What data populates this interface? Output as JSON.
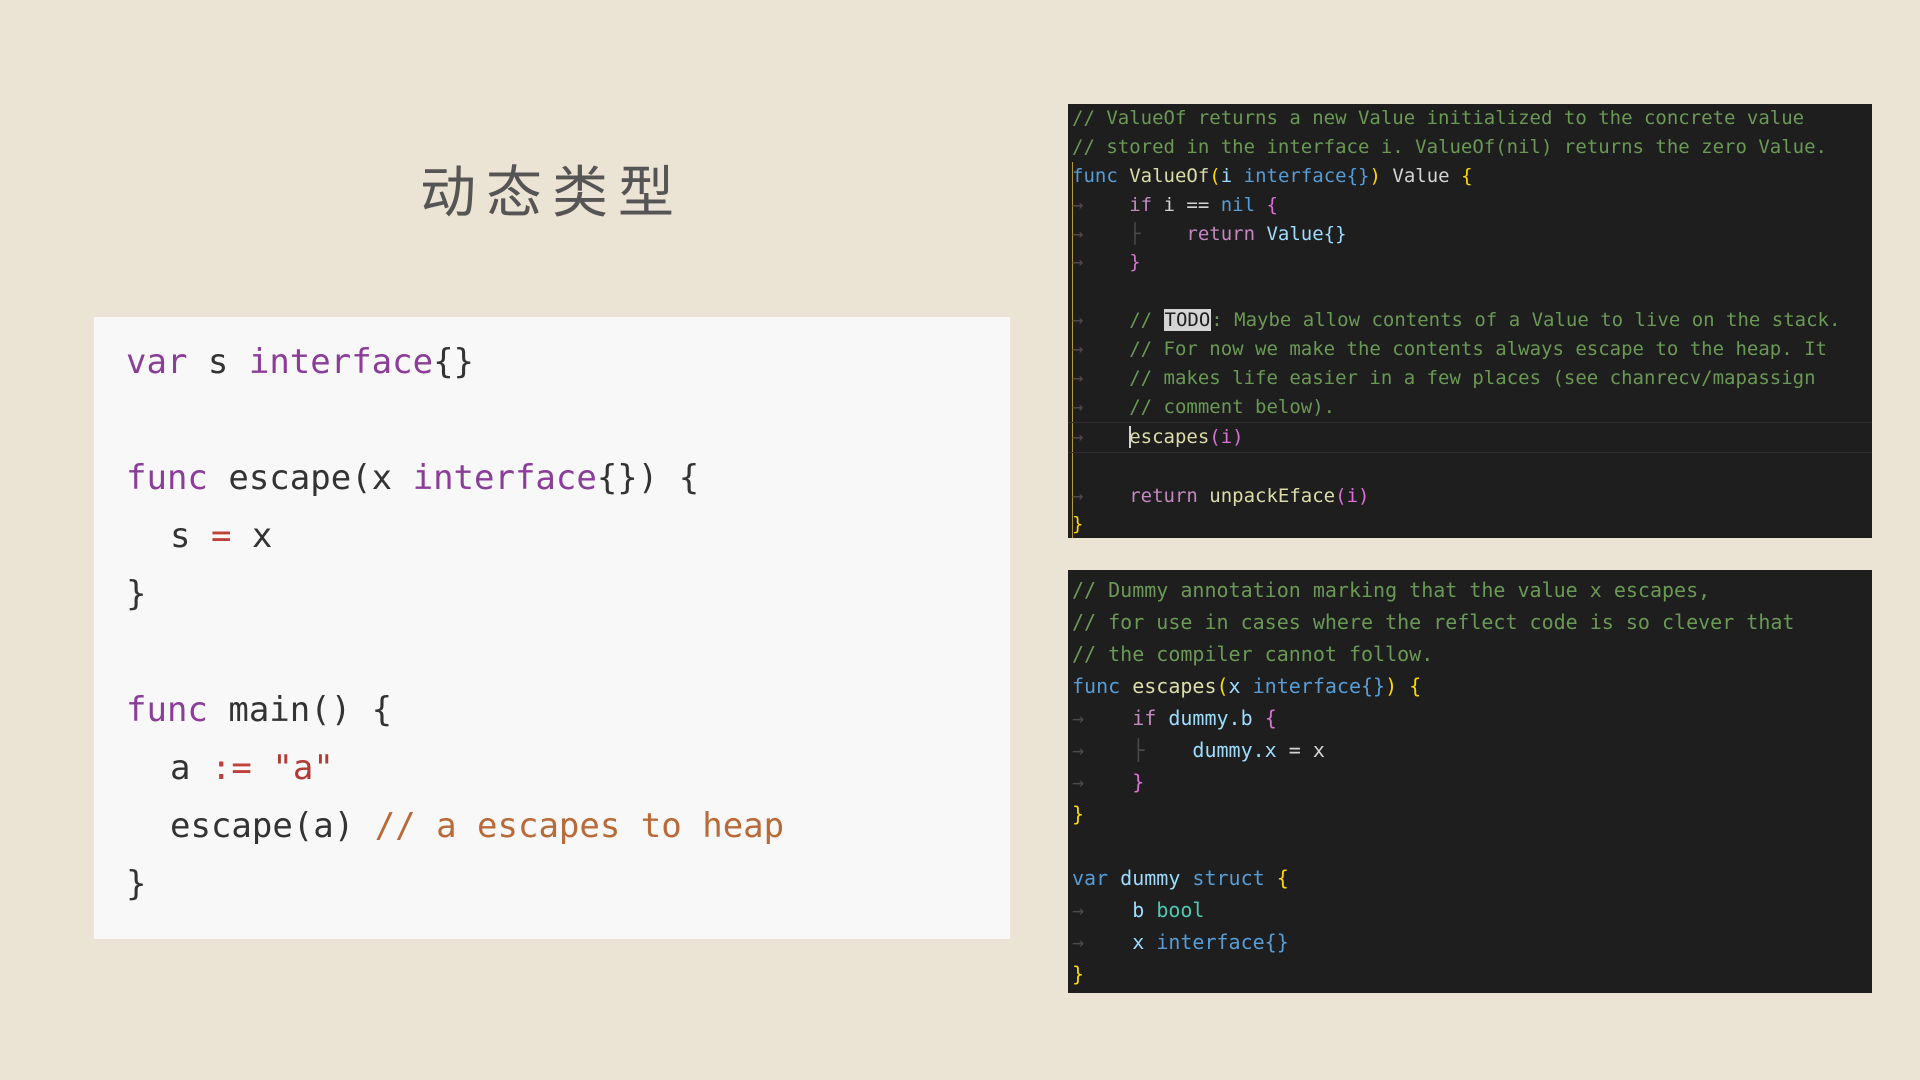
{
  "slide": {
    "title": "动态类型"
  },
  "left_code": {
    "line1": {
      "kw": "var",
      "mid": " s ",
      "type": "interface",
      "rest": "{}"
    },
    "line3": {
      "kw": "func",
      "name": " escape(x ",
      "type": "interface",
      "rest": "{}) {"
    },
    "line4": {
      "a": "s ",
      "op": "=",
      "b": " x"
    },
    "line5": "}",
    "line7": {
      "kw": "func",
      "rest": " main() {"
    },
    "line8": {
      "a": "a ",
      "op": ":=",
      "str": " \"a\""
    },
    "line9": {
      "code": "escape(a) ",
      "comment": "// a escapes to heap"
    },
    "line10": "}"
  },
  "top_panel": {
    "c1": "// ValueOf returns a new Value initialized to the concrete value",
    "c2": "// stored in the interface i. ValueOf(nil) returns the zero Value.",
    "sig_func": "func",
    "sig_name": "ValueOf",
    "sig_paren": "(",
    "sig_param": "i",
    "sig_type": "interface{}",
    "sig_close": ")",
    "sig_ret": "Value",
    "sig_brace": "{",
    "if_kw": "if",
    "if_cond": " i == ",
    "if_nil": "nil",
    "if_brace": " {",
    "ret_kw": "return",
    "ret_val": " Value{}",
    "close_if": "}",
    "todo_pre": "// ",
    "todo": "TODO",
    "todo_post": ": Maybe allow contents of a Value to live on the stack.",
    "c4": "// For now we make the contents always escape to the heap. It",
    "c5": "// makes life easier in a few places (see chanrecv/mapassign",
    "c6": "// comment below).",
    "esc_fn": "escapes",
    "esc_args": "(i)",
    "ret2_kw": "return",
    "ret2_fn": " unpackEface",
    "ret2_args": "(i)",
    "close": "}"
  },
  "bottom_panel": {
    "c1": "// Dummy annotation marking that the value x escapes,",
    "c2": "// for use in cases where the reflect code is so clever that",
    "c3": "// the compiler cannot follow.",
    "sig_func": "func",
    "sig_name": " escapes",
    "sig_paren": "(",
    "sig_param": "x ",
    "sig_type": "interface{}",
    "sig_close": ")",
    "sig_brace": " {",
    "if_kw": "if",
    "if_cond": " dummy.b ",
    "if_brace": "{",
    "assign_lhs": "dummy.x",
    "assign_rest": " = x",
    "close_if": "}",
    "close_fn": "}",
    "var_kw": "var",
    "var_name": " dummy ",
    "struct_kw": "struct",
    "struct_brace": " {",
    "field_b": "b ",
    "field_b_type": "bool",
    "field_x": "x ",
    "field_x_type": "interface{}",
    "close_struct": "}"
  }
}
